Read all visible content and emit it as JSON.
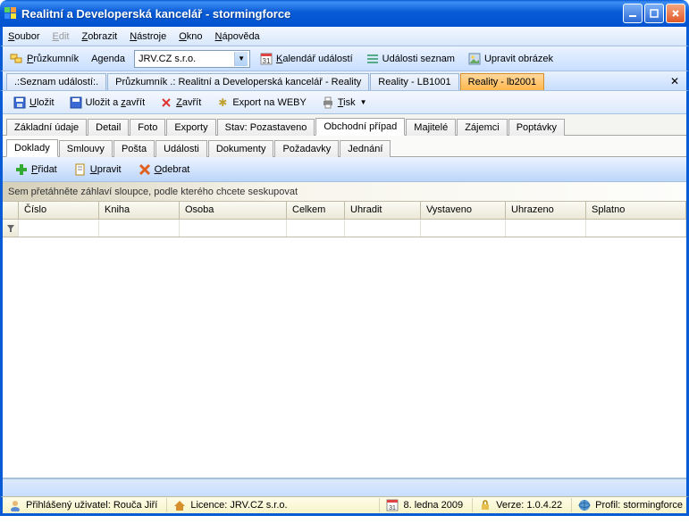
{
  "window": {
    "title": "Realitní a Developerská kancelář - stormingforce"
  },
  "menu": {
    "soubor": "Soubor",
    "edit": "Edit",
    "zobrazit": "Zobrazit",
    "nastroje": "Nástroje",
    "okno": "Okno",
    "napoveda": "Nápověda"
  },
  "toolbar1": {
    "pruzkumnik": "Průzkumník",
    "agenda": "Agenda",
    "combo_value": "JRV.CZ s.r.o.",
    "kalendar": "Kalendář událostí",
    "seznam": "Události seznam",
    "obrazek": "Upravit obrázek"
  },
  "doctabs": [
    {
      "label": ".:Seznam událostí:."
    },
    {
      "label": "Průzkumník .: Realitní a Developerská kancelář - Reality"
    },
    {
      "label": "Reality - LB1001"
    },
    {
      "label": "Reality - lb2001",
      "active": true
    }
  ],
  "toolbar2": {
    "ulozit": "Uložit",
    "ulozit_zavrit": "Uložit a zavřít",
    "zavrit": "Zavřít",
    "export_weby": "Export na WEBY",
    "tisk": "Tisk"
  },
  "uppertabs": [
    {
      "label": "Základní údaje"
    },
    {
      "label": "Detail"
    },
    {
      "label": "Foto"
    },
    {
      "label": "Exporty"
    },
    {
      "label": "Stav: Pozastaveno"
    },
    {
      "label": "Obchodní případ",
      "active": true
    },
    {
      "label": "Majitelé"
    },
    {
      "label": "Zájemci"
    },
    {
      "label": "Poptávky"
    }
  ],
  "lowertabs": [
    {
      "label": "Doklady",
      "active": true
    },
    {
      "label": "Smlouvy"
    },
    {
      "label": "Pošta"
    },
    {
      "label": "Události"
    },
    {
      "label": "Dokumenty"
    },
    {
      "label": "Požadavky"
    },
    {
      "label": "Jednání"
    }
  ],
  "toolbar3": {
    "pridat": "Přidat",
    "upravit": "Upravit",
    "odebrat": "Odebrat"
  },
  "groupbar": {
    "text": "Sem přetáhněte záhlaví sloupce, podle kterého chcete seskupovat"
  },
  "columns": [
    "Číslo",
    "Kniha",
    "Osoba",
    "Celkem",
    "Uhradit",
    "Vystaveno",
    "Uhrazeno",
    "Splatno"
  ],
  "status": {
    "user_label": "Přihlášený uživatel: ",
    "user_value": "Rouča Jiří",
    "licence_label": "Licence: ",
    "licence_value": "JRV.CZ s.r.o.",
    "date": "8. ledna 2009",
    "verze_label": "Verze: ",
    "verze_value": "1.0.4.22",
    "profil_label": "Profil: ",
    "profil_value": "stormingforce"
  }
}
